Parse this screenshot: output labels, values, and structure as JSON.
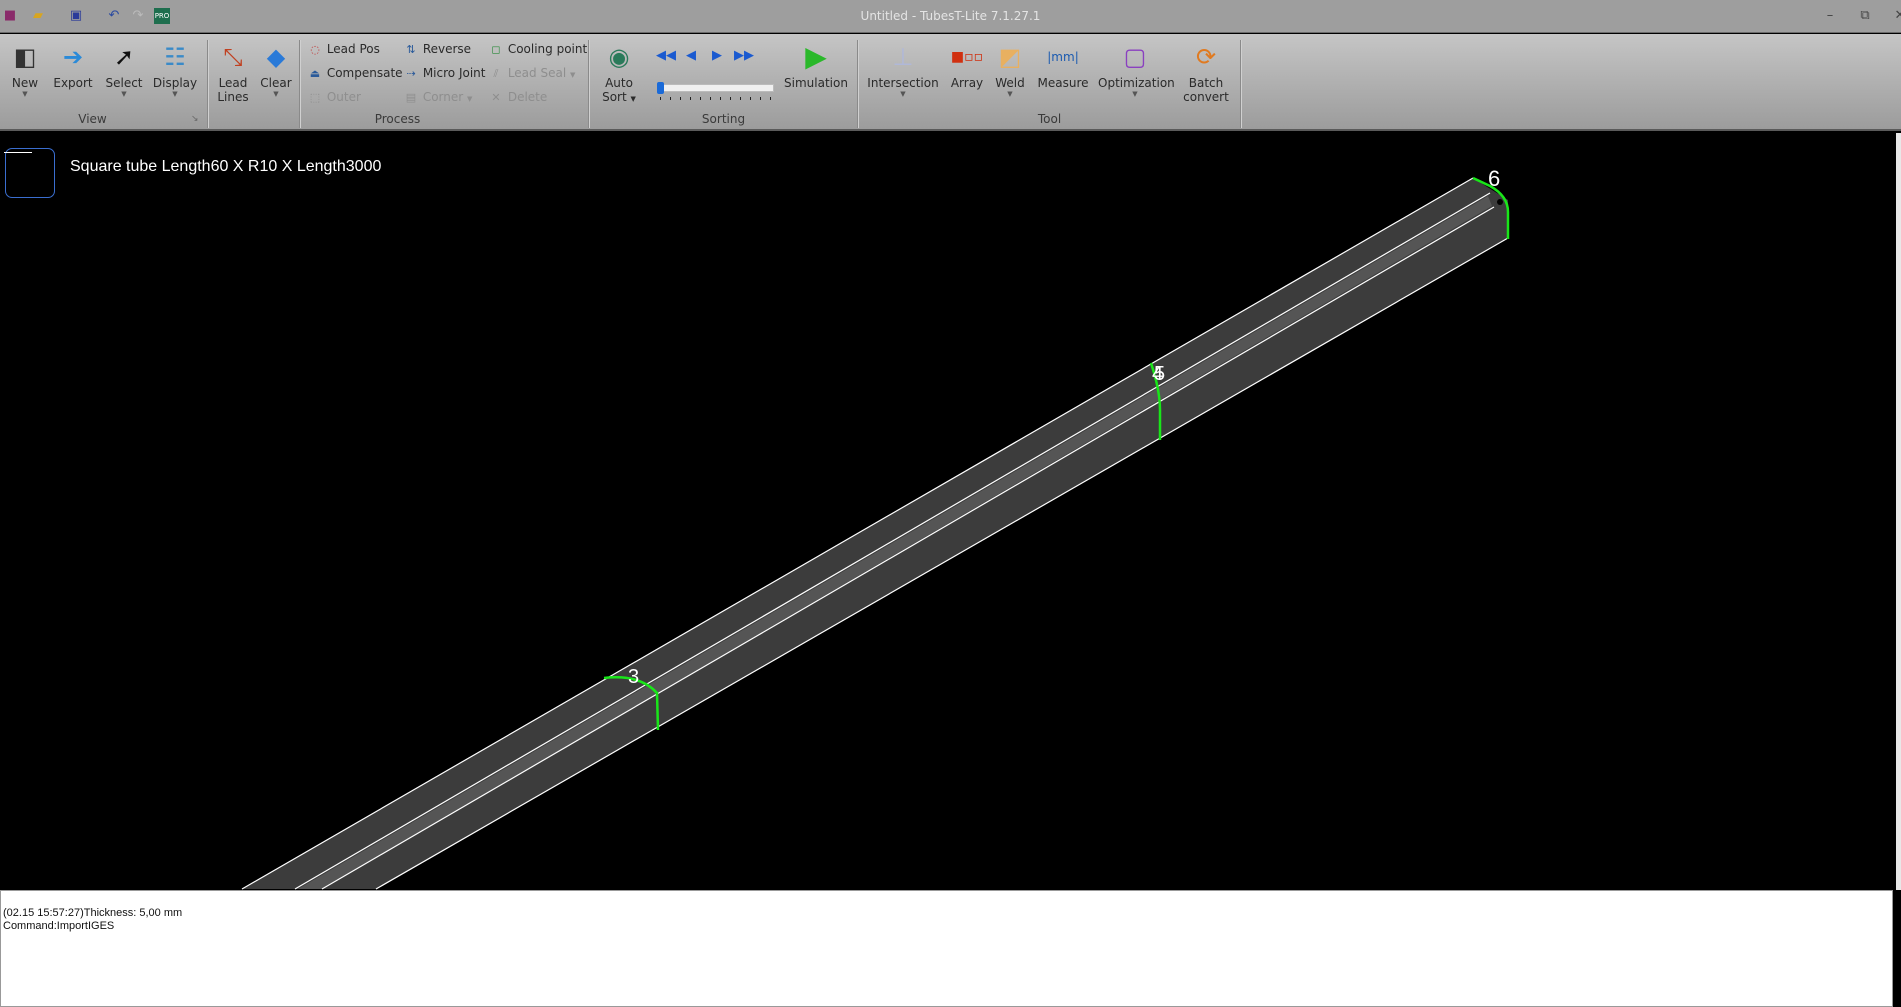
{
  "window": {
    "title": "Untitled - TubesT-Lite 7.1.27.1"
  },
  "quick_access": [
    "app-icon",
    "open-icon",
    "save-icon",
    "undo-icon",
    "redo-icon",
    "pro-upgrade-icon"
  ],
  "ribbon": {
    "groups": {
      "view": {
        "label": "View",
        "buttons": [
          "New",
          "Export",
          "Select",
          "Display"
        ]
      },
      "process": {
        "label": "Process",
        "big": [
          "Lead\nLines",
          "Clear"
        ],
        "lead_lines_1": "Lead",
        "lead_lines_2": "Lines",
        "small": [
          {
            "label": "Lead Pos",
            "enabled": true
          },
          {
            "label": "Compensate",
            "enabled": true
          },
          {
            "label": "Outer",
            "enabled": false
          },
          {
            "label": "Reverse",
            "enabled": true
          },
          {
            "label": "Micro Joint",
            "enabled": true
          },
          {
            "label": "Corner",
            "enabled": false
          },
          {
            "label": "Cooling point",
            "enabled": true
          },
          {
            "label": "Lead Seal",
            "enabled": false
          },
          {
            "label": "Delete",
            "enabled": false
          }
        ]
      },
      "sorting": {
        "label": "Sorting",
        "auto_1": "Auto",
        "auto_2": "Sort",
        "simulation": "Simulation",
        "slider_position": 0
      },
      "tool": {
        "label": "Tool",
        "buttons": [
          "Intersection",
          "Array",
          "Weld",
          "Measure",
          "Optimization"
        ],
        "batch_1": "Batch",
        "batch_2": "convert"
      }
    }
  },
  "canvas": {
    "part_label": "Square tube Length60 X R10 X Length3000",
    "markers": [
      "3",
      "4",
      "5",
      "6"
    ],
    "colors": {
      "background": "#000000",
      "tube": "#3c3c3c",
      "edge": "#ffffff",
      "cut_path": "#19e619",
      "profile": "#3a6ed0"
    }
  },
  "log": {
    "lines": [
      "(02.15 15:57:27)Thickness: 5,00 mm",
      "Command:ImportIGES"
    ]
  }
}
